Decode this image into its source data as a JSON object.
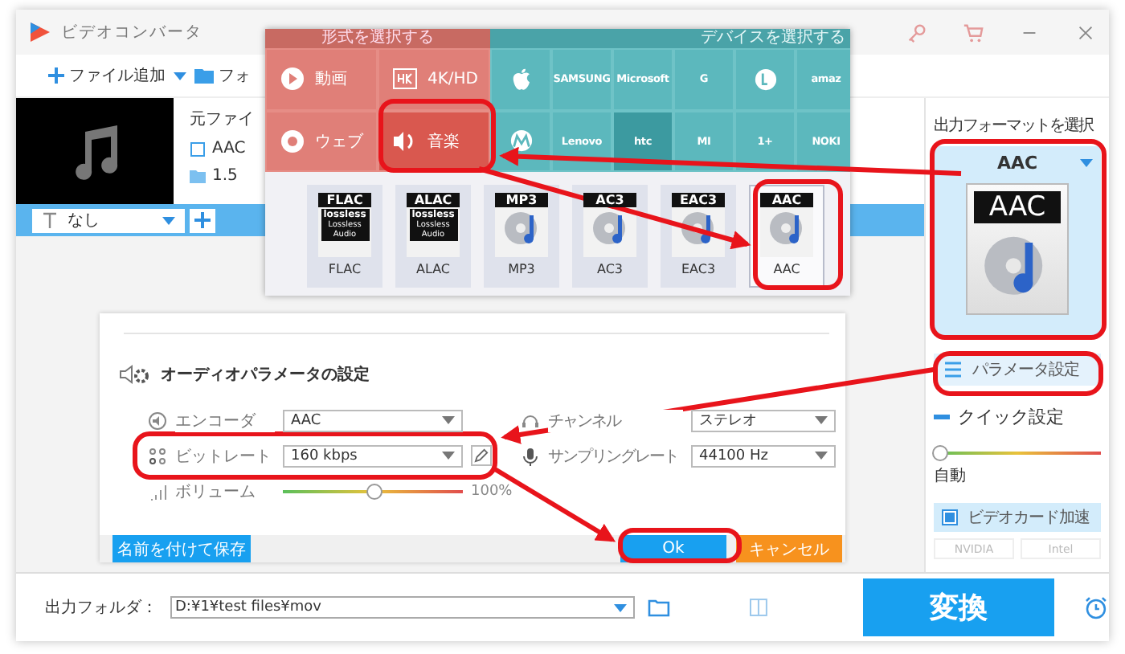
{
  "window": {
    "title": "ビデオコンバータ"
  },
  "toolbar": {
    "add_file": "ファイル追加",
    "add_folder": "フォ"
  },
  "file": {
    "heading": "元ファイ",
    "format": "AAC",
    "size": "1.5"
  },
  "subtitle": {
    "value": "なし"
  },
  "format_popup": {
    "format_header": "形式を選択する",
    "device_header": "デバイスを選択する",
    "categories": [
      {
        "kind": "video",
        "label": "動画",
        "selected": false
      },
      {
        "kind": "hd",
        "label": "4K/HD",
        "selected": false
      },
      {
        "kind": "web",
        "label": "ウェブ",
        "selected": false
      },
      {
        "kind": "music",
        "label": "音楽",
        "selected": true
      }
    ],
    "devices": [
      {
        "kind": "apple",
        "selected": false
      },
      {
        "kind": "text",
        "label": "SAMSUNG",
        "selected": false
      },
      {
        "kind": "text",
        "label": "Microsoft",
        "selected": false
      },
      {
        "kind": "text",
        "label": "G",
        "selected": false
      },
      {
        "kind": "lg",
        "selected": false
      },
      {
        "kind": "text",
        "label": "amaz",
        "selected": false
      },
      {
        "kind": "motorola",
        "selected": false
      },
      {
        "kind": "text",
        "label": "Lenovo",
        "selected": false
      },
      {
        "kind": "text",
        "label": "htc",
        "selected": true
      },
      {
        "kind": "text",
        "label": "MI",
        "selected": false
      },
      {
        "kind": "text",
        "label": "1+",
        "selected": false
      },
      {
        "kind": "text",
        "label": "NOKI",
        "selected": false
      }
    ],
    "formats": [
      {
        "kind": "lossless",
        "badge": "FLAC",
        "mark": "lossless",
        "caption": "Lossless Audio",
        "label": "FLAC",
        "selected": false
      },
      {
        "kind": "lossless",
        "badge": "ALAC",
        "mark": "lossless",
        "caption": "Lossless Audio",
        "label": "ALAC",
        "selected": false
      },
      {
        "kind": "disc",
        "badge": "MP3",
        "label": "MP3",
        "selected": false
      },
      {
        "kind": "disc",
        "badge": "AC3",
        "label": "AC3",
        "selected": false
      },
      {
        "kind": "disc",
        "badge": "EAC3",
        "label": "EAC3",
        "selected": false
      },
      {
        "kind": "disc",
        "badge": "AAC",
        "label": "AAC",
        "selected": true
      }
    ]
  },
  "dialog": {
    "title": "オーディオパラメータの設定",
    "fields": [
      {
        "kind": "select",
        "label": "エンコーダ",
        "value": "AAC"
      },
      {
        "kind": "select",
        "label": "チャンネル",
        "value": "ステレオ"
      },
      {
        "kind": "select_edit",
        "label": "ビットレート",
        "value": "160 kbps"
      },
      {
        "kind": "select",
        "label": "サンプリングレート",
        "value": "44100 Hz"
      },
      {
        "kind": "slider",
        "label": "ボリューム",
        "level": 0.5,
        "reading": "100%"
      }
    ],
    "save_button": "名前を付けて保存",
    "ok_button": "Ok",
    "cancel_button": "キャンセル"
  },
  "output_panel": {
    "title": "出力フォーマットを選択",
    "format": "AAC",
    "badge": "AAC",
    "params_button": "パラメータ設定",
    "quick_settings": "クイック設定",
    "quality": {
      "level": 0,
      "label": "自動"
    },
    "gpu": {
      "label": "ビデオカード加速",
      "checked": true
    },
    "gpu_vendors": [
      {
        "label": "NVIDIA",
        "disabled": true
      },
      {
        "label": "Intel",
        "disabled": true
      }
    ]
  },
  "bottom_bar": {
    "output_label": "出力フォルダ：",
    "output_path": "D:¥1¥test files¥mov",
    "convert_button": "変換"
  }
}
